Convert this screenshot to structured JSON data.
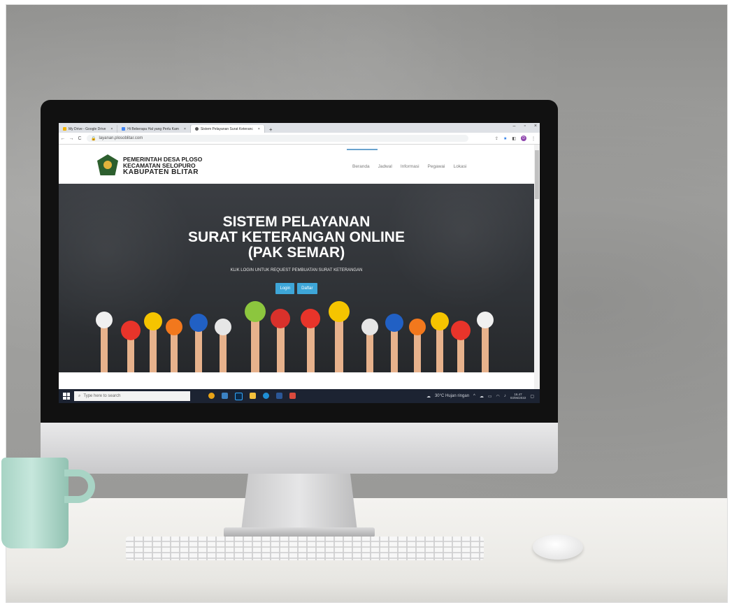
{
  "browser": {
    "tabs": [
      {
        "label": "My Drive - Google Drive",
        "active": false
      },
      {
        "label": "Hi Beberapa Hal yang Perlu Kam",
        "active": false
      },
      {
        "label": "Sistem Pelayanan Surat Keteranc",
        "active": true
      }
    ],
    "url": "layanan.plosoblitar.com"
  },
  "site": {
    "org_line1": "PEMERINTAH DESA PLOSO",
    "org_line2": "KECAMATAN SELOPURO",
    "org_line3": "KABUPATEN BLITAR",
    "nav": [
      "Beranda",
      "Jadwal",
      "Informasi",
      "Pegawai",
      "Lokasi"
    ],
    "hero_line1": "SISTEM PELAYANAN",
    "hero_line2": "SURAT KETERANGAN ONLINE",
    "hero_line3": "(PAK SEMAR)",
    "hero_sub": "KLIK LOGIN UNTUK REQUEST PEMBUATAN SURAT KETERANGAN",
    "login_label": "Login",
    "daftar_label": "Daftar"
  },
  "taskbar": {
    "search_placeholder": "Type here to search",
    "weather": "30°C Hujan ringan",
    "time": "16.47",
    "date": "03/06/2022"
  }
}
